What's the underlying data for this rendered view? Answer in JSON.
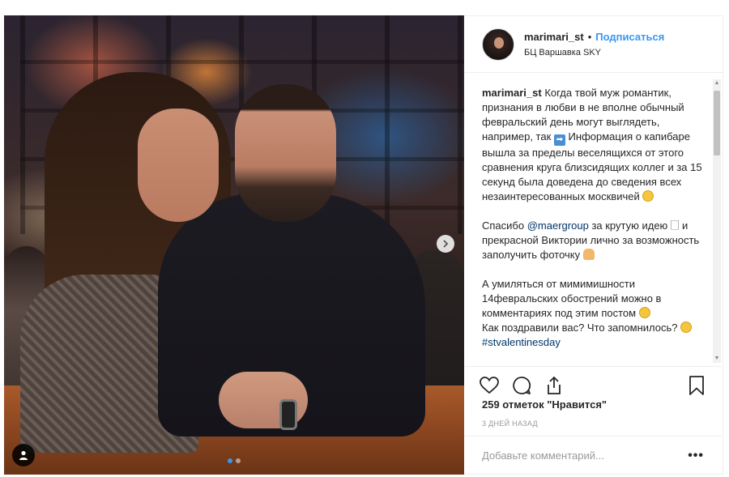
{
  "post": {
    "username": "marimari_st",
    "separator": "•",
    "follow_label": "Подписаться",
    "location": "БЦ Варшавка SKY",
    "caption_username": "marimari_st",
    "caption_part1": "Когда твой муж романтик, признания в любви в не вполне обычный февральский день могут выглядеть, например, так",
    "caption_part2": "Информация о капибаре вышла за пределы веселящихся от этого сравнения круга близсидящих коллег и за 15 секунд была доведена до сведения всех незаинтересованных москвичей",
    "caption_p2_before": "Спасибо",
    "caption_mention": "@maergroup",
    "caption_p2_after": "за крутую идею 🗌 и прекрасной Виктории лично за возможность заполучить фоточку",
    "caption_p3": "А умиляться от мимимишности 14февральских обострений можно в комментариях под этим постом",
    "caption_p3_question": "Как поздравили вас? Что запомнилось?",
    "hashtag": "#stvalentinesday",
    "likes_text": "259 отметок \"Нравится\"",
    "time_ago": "3 ДНЕЙ НАЗАД",
    "comment_placeholder": "Добавьте комментарий...",
    "more_label": "•••"
  },
  "icons": {
    "heart": "heart-icon",
    "comment": "comment-icon",
    "share": "share-icon",
    "save": "bookmark-icon",
    "next": "chevron-right-icon",
    "tag": "user-tag-icon"
  },
  "carousel": {
    "count": 2,
    "active": 1
  },
  "colors": {
    "accent": "#3897f0",
    "text": "#262626",
    "muted": "#999999",
    "border": "#efefef"
  }
}
